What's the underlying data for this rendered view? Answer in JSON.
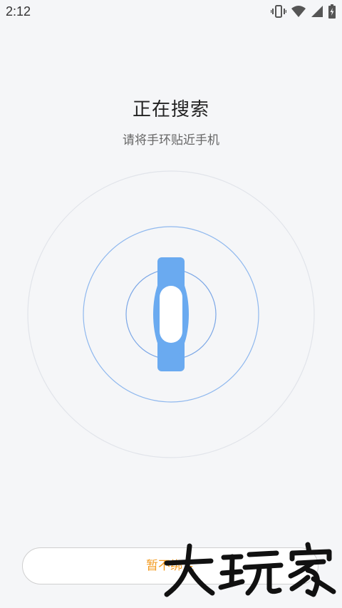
{
  "status_bar": {
    "time": "2:12",
    "icons": [
      "vibrate-icon",
      "wifi-icon",
      "signal-icon",
      "battery-charging-icon"
    ]
  },
  "main": {
    "title": "正在搜索",
    "subtitle": "请将手环贴近手机"
  },
  "radar": {
    "device_icon": "fitness-band-icon",
    "colors": {
      "band": "#6aaaf0",
      "band_window": "#ffffff",
      "inner_ring": "#7aa6e6",
      "middle_ring": "#8fb8ee",
      "outer_ring": "#e1e4ea"
    }
  },
  "footer": {
    "skip_bind_label": "暂不绑定"
  },
  "watermark": {
    "text": "大玩家"
  },
  "colors": {
    "background": "#f5f6f8",
    "accent": "#f39a1e"
  }
}
